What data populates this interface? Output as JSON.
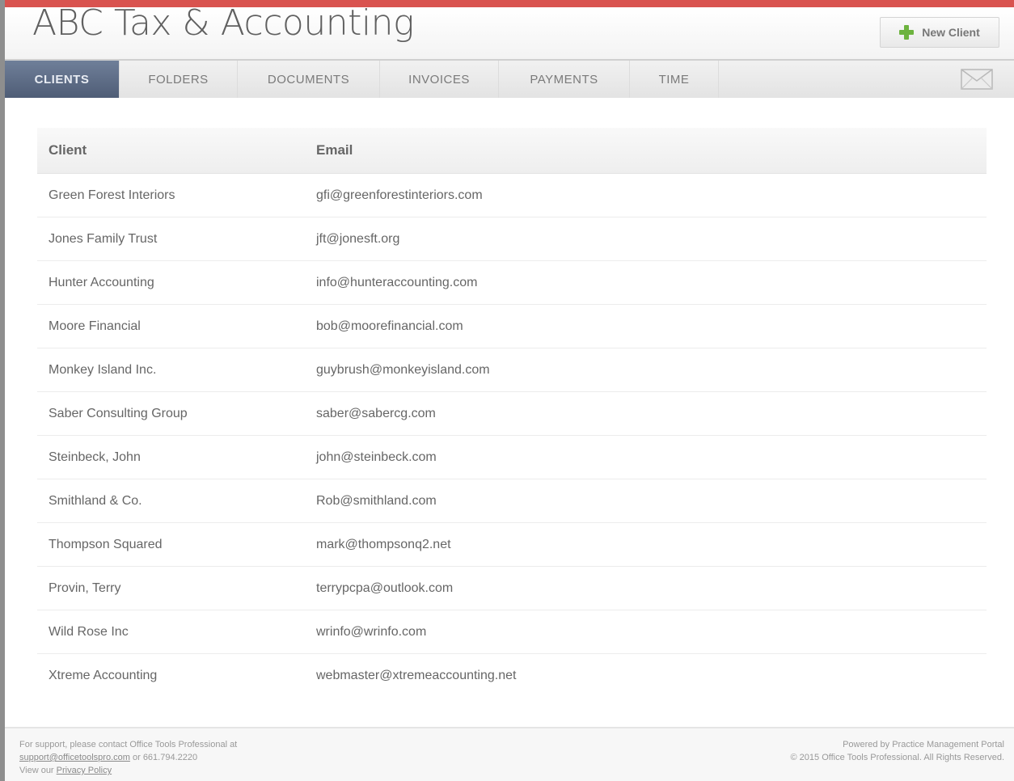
{
  "header": {
    "title": "ABC Tax & Accounting",
    "new_client_label": "New Client"
  },
  "nav": {
    "tabs": [
      {
        "label": "CLIENTS",
        "active": true
      },
      {
        "label": "FOLDERS",
        "active": false
      },
      {
        "label": "DOCUMENTS",
        "active": false
      },
      {
        "label": "INVOICES",
        "active": false
      },
      {
        "label": "PAYMENTS",
        "active": false
      },
      {
        "label": "TIME",
        "active": false
      }
    ]
  },
  "table": {
    "columns": [
      "Client",
      "Email"
    ],
    "rows": [
      {
        "client": "Green Forest Interiors",
        "email": "gfi@greenforestinteriors.com"
      },
      {
        "client": "Jones Family Trust",
        "email": "jft@jonesft.org"
      },
      {
        "client": "Hunter Accounting",
        "email": "info@hunteraccounting.com"
      },
      {
        "client": "Moore Financial",
        "email": "bob@moorefinancial.com"
      },
      {
        "client": "Monkey Island Inc.",
        "email": "guybrush@monkeyisland.com"
      },
      {
        "client": "Saber Consulting Group",
        "email": "saber@sabercg.com"
      },
      {
        "client": "Steinbeck, John",
        "email": "john@steinbeck.com"
      },
      {
        "client": "Smithland & Co.",
        "email": "Rob@smithland.com"
      },
      {
        "client": "Thompson Squared",
        "email": "mark@thompsonq2.net"
      },
      {
        "client": "Provin, Terry",
        "email": "terrypcpa@outlook.com"
      },
      {
        "client": "Wild Rose Inc",
        "email": "wrinfo@wrinfo.com"
      },
      {
        "client": "Xtreme Accounting",
        "email": "webmaster@xtremeaccounting.net"
      }
    ]
  },
  "footer": {
    "support_text": "For support, please contact Office Tools Professional at",
    "support_email": "support@officetoolspro.com",
    "support_phone": " or 661.794.2220",
    "view_our": "View our ",
    "privacy_label": "Privacy Policy",
    "powered_by": "Powered by Practice Management Portal",
    "copyright": "© 2015 Office Tools Professional. All Rights Reserved."
  },
  "colors": {
    "top_bar": "#d9534f",
    "active_tab": "#5a6882",
    "plus_icon": "#6db33f"
  },
  "icons": [
    "plus-icon",
    "mail-icon"
  ]
}
